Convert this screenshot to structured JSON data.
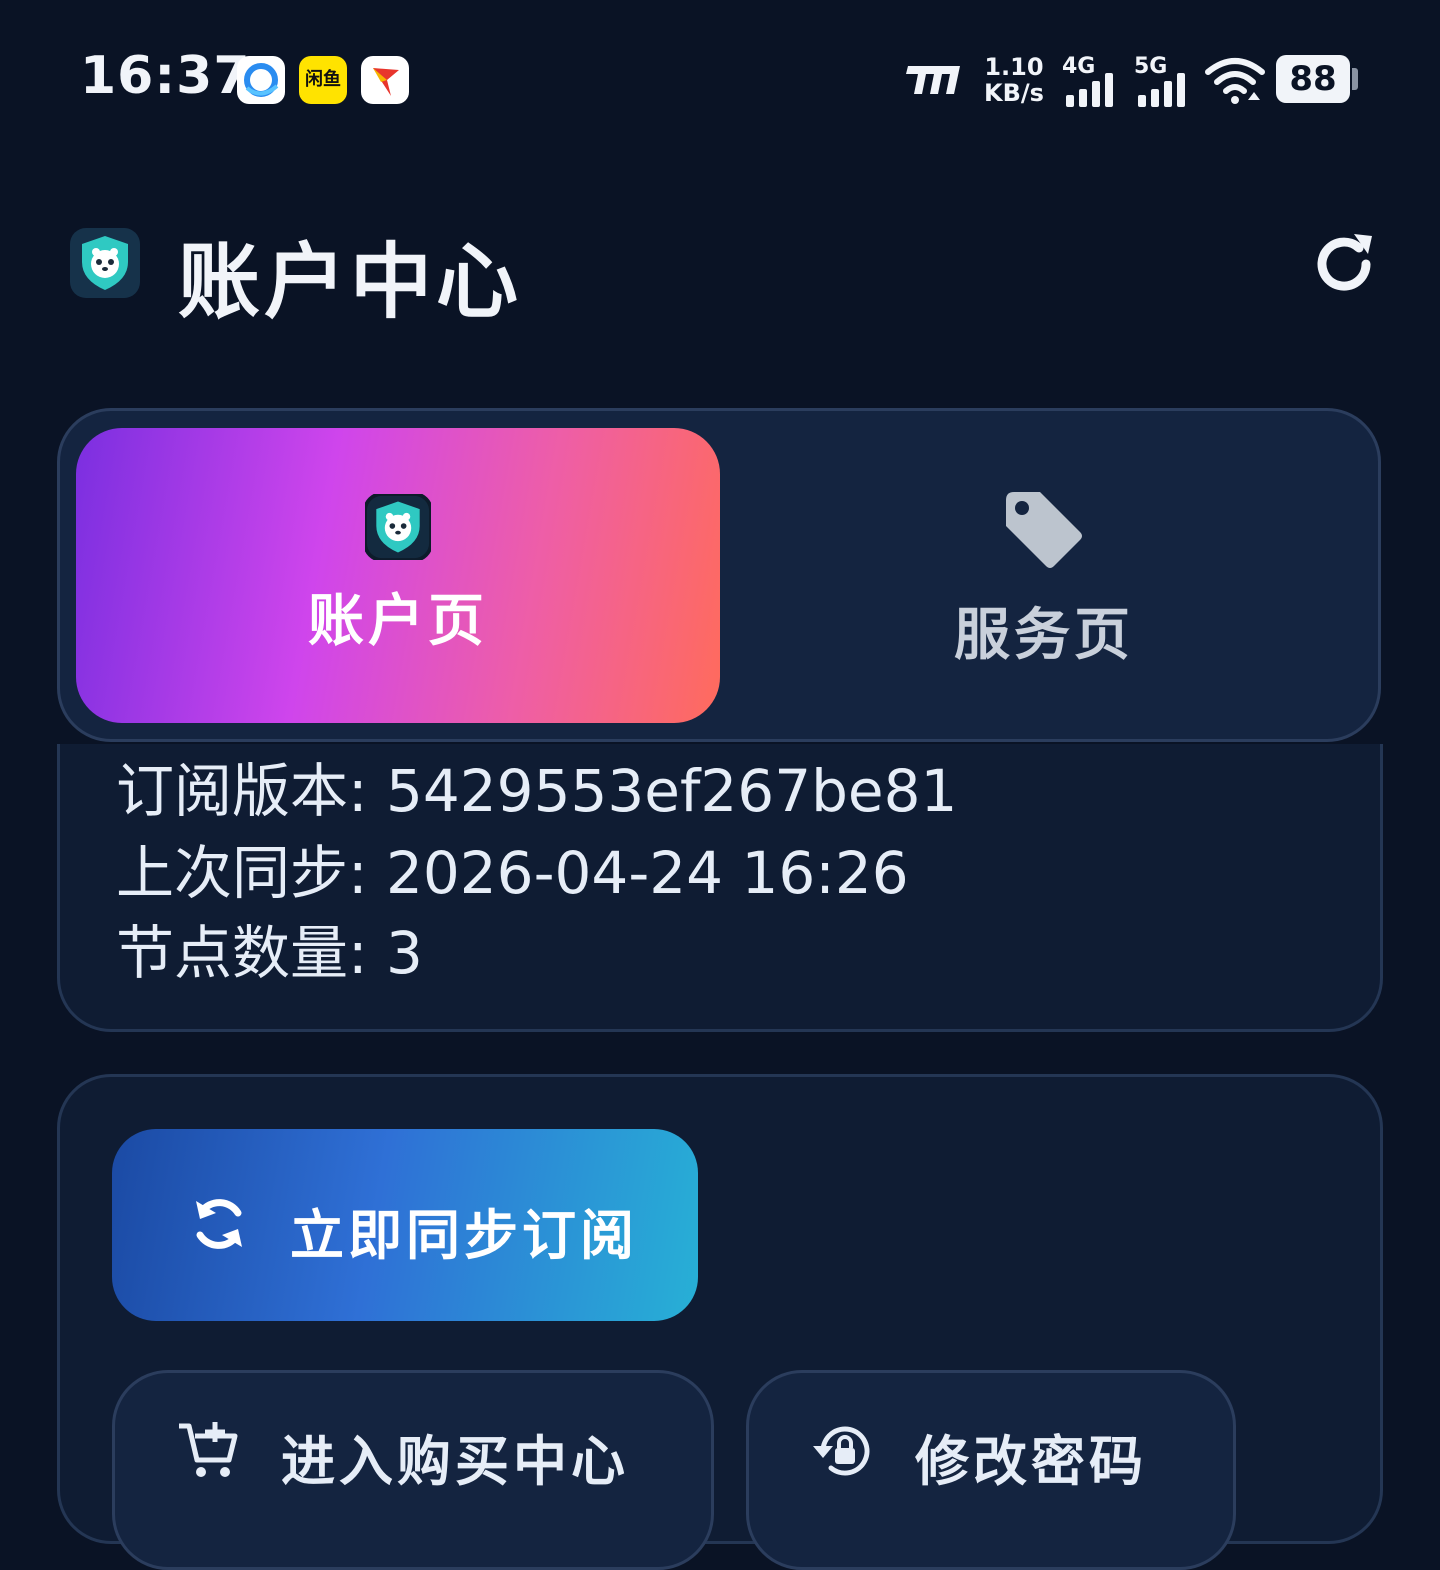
{
  "status_bar": {
    "time": "16:37",
    "notif_app_2_text": "闲鱼",
    "net_speed_value": "1.10",
    "net_speed_unit": "KB/s",
    "sim1_label": "4G",
    "sim2_label": "5G",
    "battery": "88",
    "icons": [
      "qq-browser-icon",
      "xianyu-icon",
      "flag-app-icon",
      "signal-brand-icon",
      "signal-4g-icon",
      "signal-5g-icon",
      "wifi-icon",
      "battery-icon"
    ]
  },
  "header": {
    "title": "账户中心",
    "refresh_icon": "refresh-icon"
  },
  "tabs": [
    {
      "label": "账户页",
      "icon": "app-logo-icon",
      "active": true
    },
    {
      "label": "服务页",
      "icon": "tag-icon",
      "active": false
    }
  ],
  "info": {
    "lines": [
      "订阅版本: 5429553ef267be81",
      "上次同步: 2026-04-24 16:26",
      "节点数量: 3"
    ]
  },
  "actions": {
    "sync_label": "立即同步订阅",
    "buy_label": "进入购买中心",
    "password_label": "修改密码"
  },
  "colors": {
    "background": "#0a1325",
    "card": "#142440",
    "accent_gradient_start": "#7b2fe0",
    "accent_gradient_end": "#ff6b5c",
    "sync_gradient_start": "#1b4aa4",
    "sync_gradient_end": "#27b0d6"
  }
}
